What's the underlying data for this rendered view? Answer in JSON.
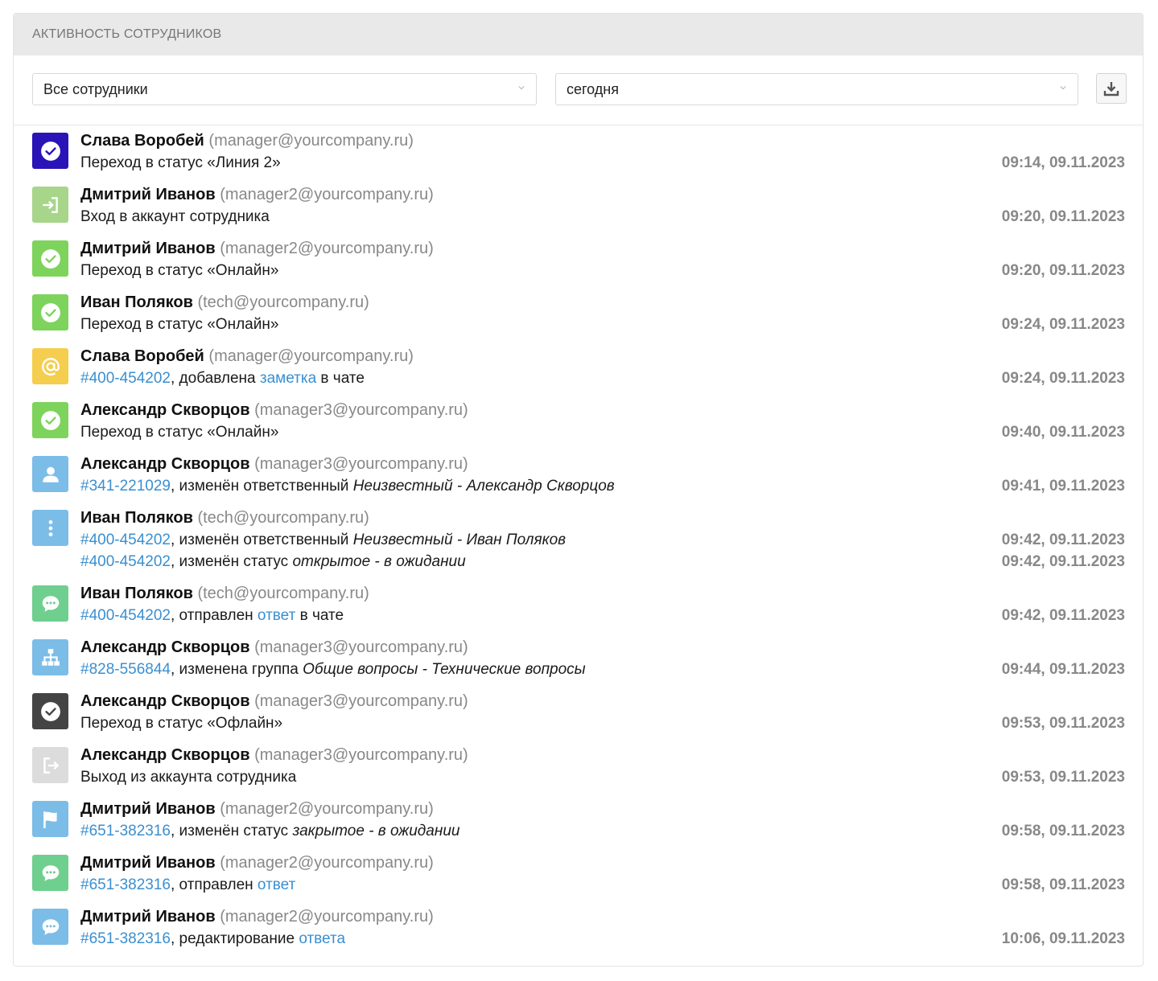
{
  "header": {
    "title": "АКТИВНОСТЬ СОТРУДНИКОВ"
  },
  "filters": {
    "employees": "Все сотрудники",
    "period": "сегодня",
    "download_icon": "download-icon"
  },
  "entries": [
    {
      "icon": "check-circle-icon",
      "color": "#2a14b8",
      "name": "Слава Воробей",
      "email": "(manager@yourcompany.ru)",
      "actions": [
        {
          "parts": [
            {
              "t": "Переход в статус «Линия 2»"
            }
          ],
          "time": "09:14, 09.11.2023"
        }
      ]
    },
    {
      "icon": "login-icon",
      "color": "#a7d58a",
      "name": "Дмитрий Иванов",
      "email": "(manager2@yourcompany.ru)",
      "actions": [
        {
          "parts": [
            {
              "t": "Вход в аккаунт сотрудника"
            }
          ],
          "time": "09:20, 09.11.2023"
        }
      ]
    },
    {
      "icon": "check-circle-icon",
      "color": "#7ed35c",
      "name": "Дмитрий Иванов",
      "email": "(manager2@yourcompany.ru)",
      "actions": [
        {
          "parts": [
            {
              "t": "Переход в статус «Онлайн»"
            }
          ],
          "time": "09:20, 09.11.2023"
        }
      ]
    },
    {
      "icon": "check-circle-icon",
      "color": "#7ed35c",
      "name": "Иван Поляков",
      "email": "(tech@yourcompany.ru)",
      "actions": [
        {
          "parts": [
            {
              "t": "Переход в статус «Онлайн»"
            }
          ],
          "time": "09:24, 09.11.2023"
        }
      ]
    },
    {
      "icon": "at-icon",
      "color": "#f5cd4f",
      "name": "Слава Воробей",
      "email": "(manager@yourcompany.ru)",
      "actions": [
        {
          "parts": [
            {
              "t": "#400-454202",
              "k": "link"
            },
            {
              "t": ", добавлена "
            },
            {
              "t": "заметка",
              "k": "link"
            },
            {
              "t": " в чате"
            }
          ],
          "time": "09:24, 09.11.2023"
        }
      ]
    },
    {
      "icon": "check-circle-icon",
      "color": "#7ed35c",
      "name": "Александр Скворцов",
      "email": "(manager3@yourcompany.ru)",
      "actions": [
        {
          "parts": [
            {
              "t": "Переход в статус «Онлайн»"
            }
          ],
          "time": "09:40, 09.11.2023"
        }
      ]
    },
    {
      "icon": "user-icon",
      "color": "#7cbde8",
      "name": "Александр Скворцов",
      "email": "(manager3@yourcompany.ru)",
      "actions": [
        {
          "parts": [
            {
              "t": "#341-221029",
              "k": "link"
            },
            {
              "t": ", изменён ответственный "
            },
            {
              "t": "Неизвестный - Александр Скворцов",
              "k": "it"
            }
          ],
          "time": "09:41, 09.11.2023"
        }
      ]
    },
    {
      "icon": "dots-vertical-icon",
      "color": "#7cbde8",
      "name": "Иван Поляков",
      "email": "(tech@yourcompany.ru)",
      "actions": [
        {
          "parts": [
            {
              "t": "#400-454202",
              "k": "link"
            },
            {
              "t": ", изменён ответственный "
            },
            {
              "t": "Неизвестный - Иван Поляков",
              "k": "it"
            }
          ],
          "time": "09:42, 09.11.2023"
        },
        {
          "parts": [
            {
              "t": "#400-454202",
              "k": "link"
            },
            {
              "t": ", изменён статус "
            },
            {
              "t": "открытое - в ожидании",
              "k": "it"
            }
          ],
          "time": "09:42, 09.11.2023"
        }
      ]
    },
    {
      "icon": "chat-bubble-icon",
      "color": "#6fcf8f",
      "name": "Иван Поляков",
      "email": "(tech@yourcompany.ru)",
      "actions": [
        {
          "parts": [
            {
              "t": "#400-454202",
              "k": "link"
            },
            {
              "t": ", отправлен "
            },
            {
              "t": "ответ",
              "k": "link"
            },
            {
              "t": " в чате"
            }
          ],
          "time": "09:42, 09.11.2023"
        }
      ]
    },
    {
      "icon": "sitemap-icon",
      "color": "#7cbde8",
      "name": "Александр Скворцов",
      "email": "(manager3@yourcompany.ru)",
      "actions": [
        {
          "parts": [
            {
              "t": "#828-556844",
              "k": "link"
            },
            {
              "t": ", изменена группа "
            },
            {
              "t": "Общие вопросы - Технические вопросы",
              "k": "it"
            }
          ],
          "time": "09:44, 09.11.2023"
        }
      ]
    },
    {
      "icon": "check-circle-icon",
      "color": "#444444",
      "name": "Александр Скворцов",
      "email": "(manager3@yourcompany.ru)",
      "actions": [
        {
          "parts": [
            {
              "t": "Переход в статус «Офлайн»"
            }
          ],
          "time": "09:53, 09.11.2023"
        }
      ]
    },
    {
      "icon": "logout-icon",
      "color": "#dcdcdc",
      "name": "Александр Скворцов",
      "email": "(manager3@yourcompany.ru)",
      "actions": [
        {
          "parts": [
            {
              "t": "Выход из аккаунта сотрудника"
            }
          ],
          "time": "09:53, 09.11.2023"
        }
      ]
    },
    {
      "icon": "flag-icon",
      "color": "#7cbde8",
      "name": "Дмитрий Иванов",
      "email": "(manager2@yourcompany.ru)",
      "actions": [
        {
          "parts": [
            {
              "t": "#651-382316",
              "k": "link"
            },
            {
              "t": ", изменён статус "
            },
            {
              "t": "закрытое - в ожидании",
              "k": "it"
            }
          ],
          "time": "09:58, 09.11.2023"
        }
      ]
    },
    {
      "icon": "chat-bubble-icon",
      "color": "#6fcf8f",
      "name": "Дмитрий Иванов",
      "email": "(manager2@yourcompany.ru)",
      "actions": [
        {
          "parts": [
            {
              "t": "#651-382316",
              "k": "link"
            },
            {
              "t": ", отправлен "
            },
            {
              "t": "ответ",
              "k": "link"
            }
          ],
          "time": "09:58, 09.11.2023"
        }
      ]
    },
    {
      "icon": "chat-bubble-icon",
      "color": "#7cbde8",
      "name": "Дмитрий Иванов",
      "email": "(manager2@yourcompany.ru)",
      "actions": [
        {
          "parts": [
            {
              "t": "#651-382316",
              "k": "link"
            },
            {
              "t": ", редактирование "
            },
            {
              "t": "ответа",
              "k": "link"
            }
          ],
          "time": "10:06, 09.11.2023"
        }
      ]
    }
  ]
}
